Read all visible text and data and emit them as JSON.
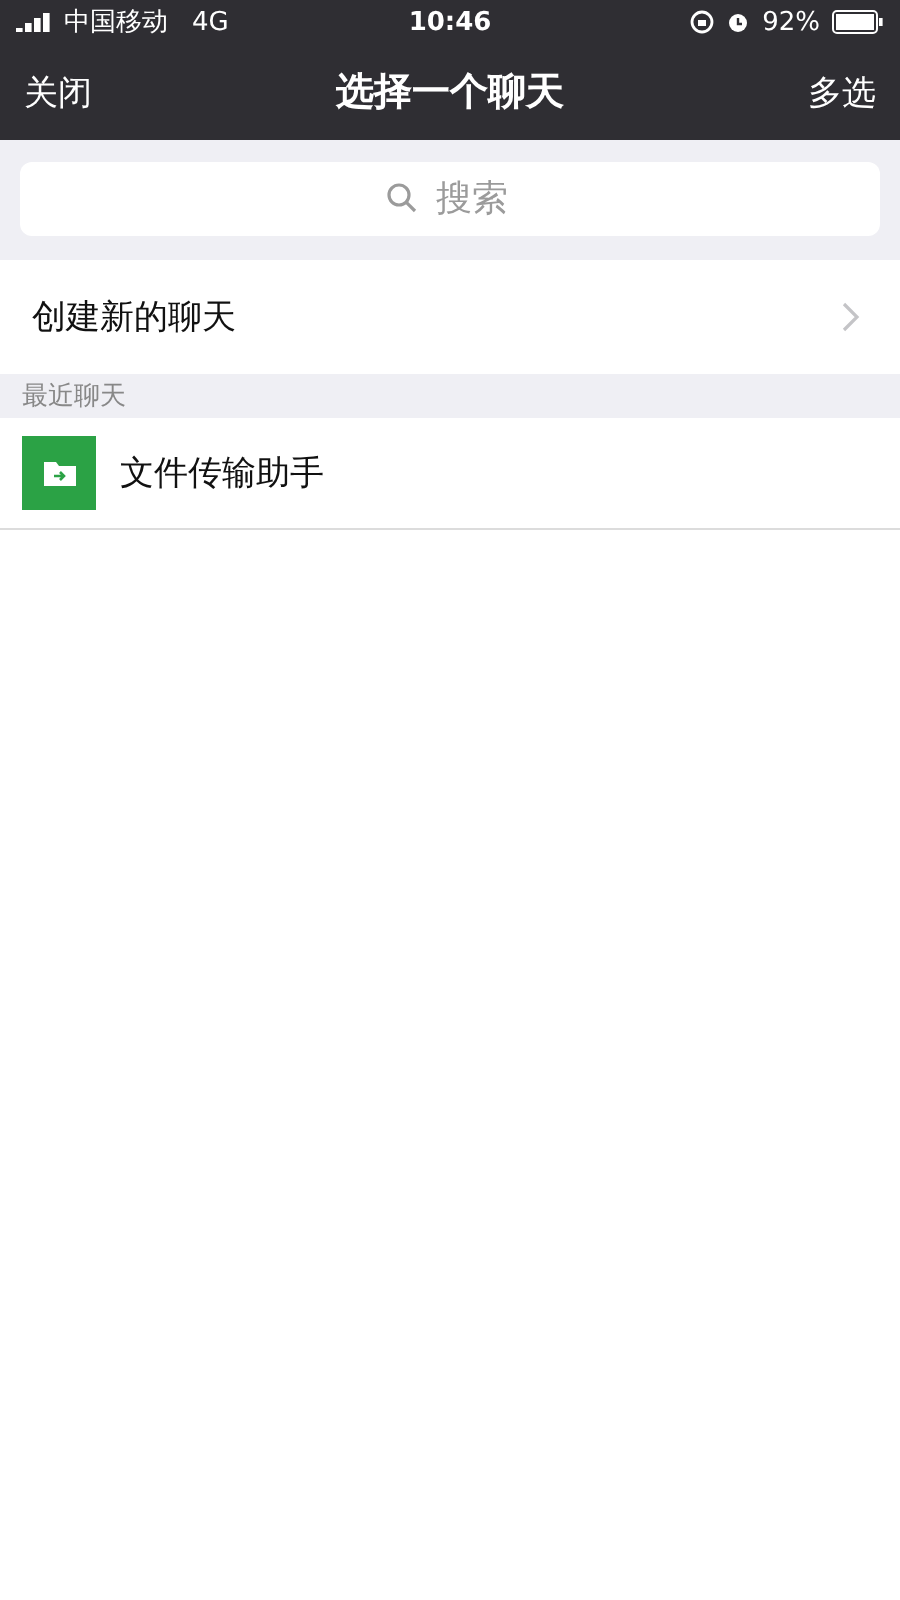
{
  "status_bar": {
    "carrier": "中国移动",
    "network": "4G",
    "time": "10:46",
    "battery": "92%"
  },
  "nav": {
    "left": "关闭",
    "title": "选择一个聊天",
    "right": "多选"
  },
  "search": {
    "placeholder": "搜索"
  },
  "create_chat": {
    "label": "创建新的聊天"
  },
  "section": {
    "title": "最近聊天"
  },
  "chats": [
    {
      "name": "文件传输助手"
    }
  ]
}
